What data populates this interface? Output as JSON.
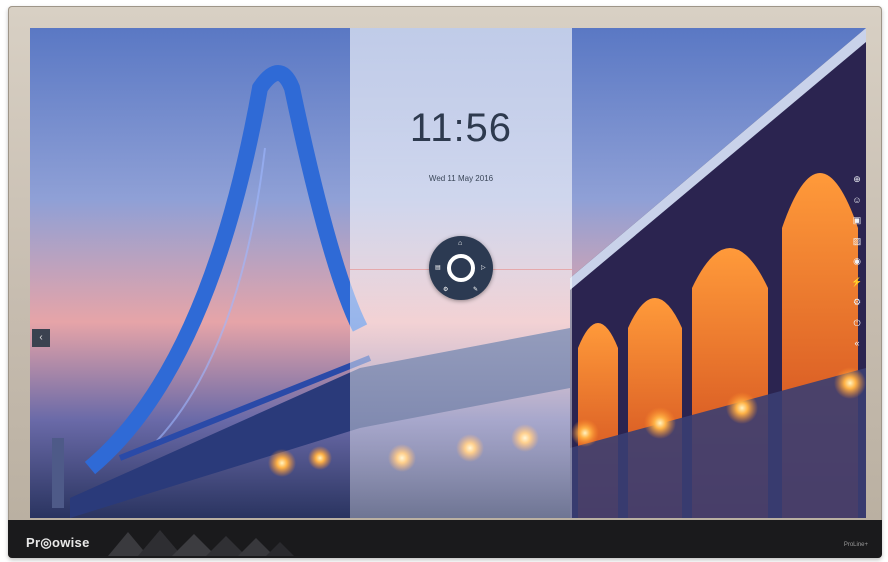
{
  "lockscreen": {
    "time": "11:56",
    "date": "Wed 11 May 2016"
  },
  "dial": {
    "top_icon": "home-icon",
    "left_label": "▤",
    "right_label": "▷",
    "bottom_left_label": "⚙",
    "bottom_right_label": "✎"
  },
  "left_handle": {
    "glyph": "‹"
  },
  "right_toolbar": {
    "items": [
      {
        "icon": "add-icon",
        "glyph": "⊕"
      },
      {
        "icon": "user-icon",
        "glyph": "☺"
      },
      {
        "icon": "screen-icon",
        "glyph": "▣"
      },
      {
        "icon": "image-icon",
        "glyph": "▨"
      },
      {
        "icon": "eye-icon",
        "glyph": "◉"
      },
      {
        "icon": "bolt-icon",
        "glyph": "⚡"
      },
      {
        "icon": "settings-icon",
        "glyph": "⚙"
      },
      {
        "icon": "power-icon",
        "glyph": "⏻"
      },
      {
        "icon": "collapse-icon",
        "glyph": "«"
      }
    ]
  },
  "bezel": {
    "brand": "Pr◎owise",
    "model": "ProLine+"
  },
  "colors": {
    "accent": "#2c3a52",
    "bezel": "#c6bcaf",
    "bottom_bar": "#1a1a1c"
  }
}
